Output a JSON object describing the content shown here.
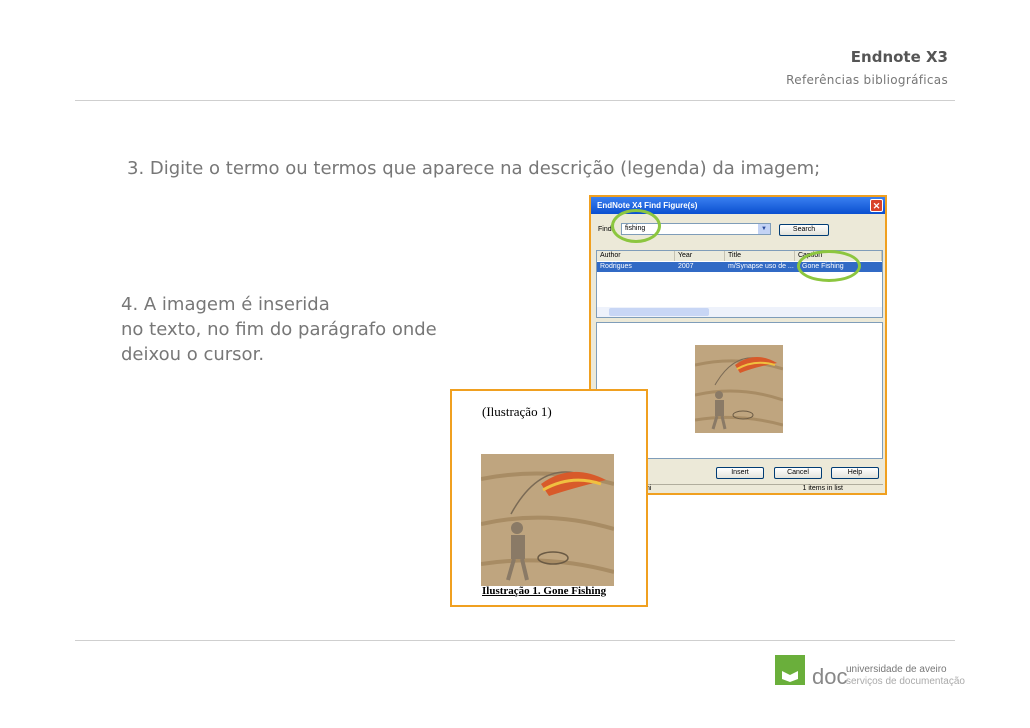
{
  "header": {
    "title": "Endnote X3",
    "subtitle": "Referências bibliográficas"
  },
  "steps": {
    "step3": "3. Digite o termo ou termos que aparece na descrição (legenda) da imagem;",
    "step4_lines": [
      "4. A imagem é inserida",
      "no texto, no fim do parágrafo onde",
      "deixou o cursor."
    ]
  },
  "dialog": {
    "title": "EndNote X4 Find Figure(s)",
    "close_icon": "close-icon",
    "find_label": "Find",
    "find_value": "fishing",
    "search_button": "Search",
    "columns": [
      "Author",
      "Year",
      "Title",
      "Caption"
    ],
    "row": {
      "author": "Rodrigues",
      "year": "2007",
      "title": "m/Synapse uso de ...",
      "caption": "Gone Fishing"
    },
    "insert_button": "Insert",
    "cancel_button": "Cancel",
    "help_button": "Help",
    "status_left": "ni",
    "status_count": "1 items in list",
    "highlight_color": "#8cc63f"
  },
  "document_snippet": {
    "caption_top": "(Ilustração 1)",
    "caption_bottom": "Ilustração 1. Gone Fishing"
  },
  "footer_logo": {
    "brand": "doc",
    "line1": "universidade de aveiro",
    "line2": "serviços de documentação",
    "color": "#6aaf3b"
  }
}
